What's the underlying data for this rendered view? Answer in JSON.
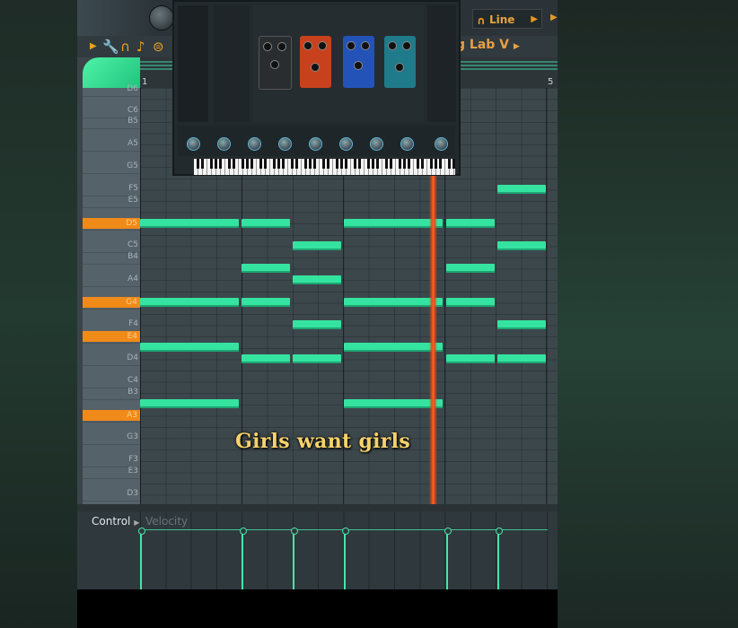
{
  "toolbar": {
    "line_label": "Line",
    "plugin_title": "g Lab V",
    "timeline_numbers": [
      "1",
      "5"
    ]
  },
  "piano_keys": [
    "D6",
    "C6",
    "B5",
    "A5",
    "G5",
    "F5",
    "E5",
    "D5",
    "C5",
    "B4",
    "A4",
    "G4",
    "F4",
    "E4",
    "D4",
    "C4",
    "B3",
    "A3",
    "G3",
    "F3",
    "E3",
    "D3"
  ],
  "highlighted_keys": [
    "D5",
    "G4",
    "E4",
    "A3"
  ],
  "control": {
    "label": "Control",
    "lane": "Velocity"
  },
  "caption": "Girls want girls",
  "colors": {
    "note": "#35e3a0",
    "highlight": "#f08a18",
    "playhead": "#ff5a20"
  }
}
